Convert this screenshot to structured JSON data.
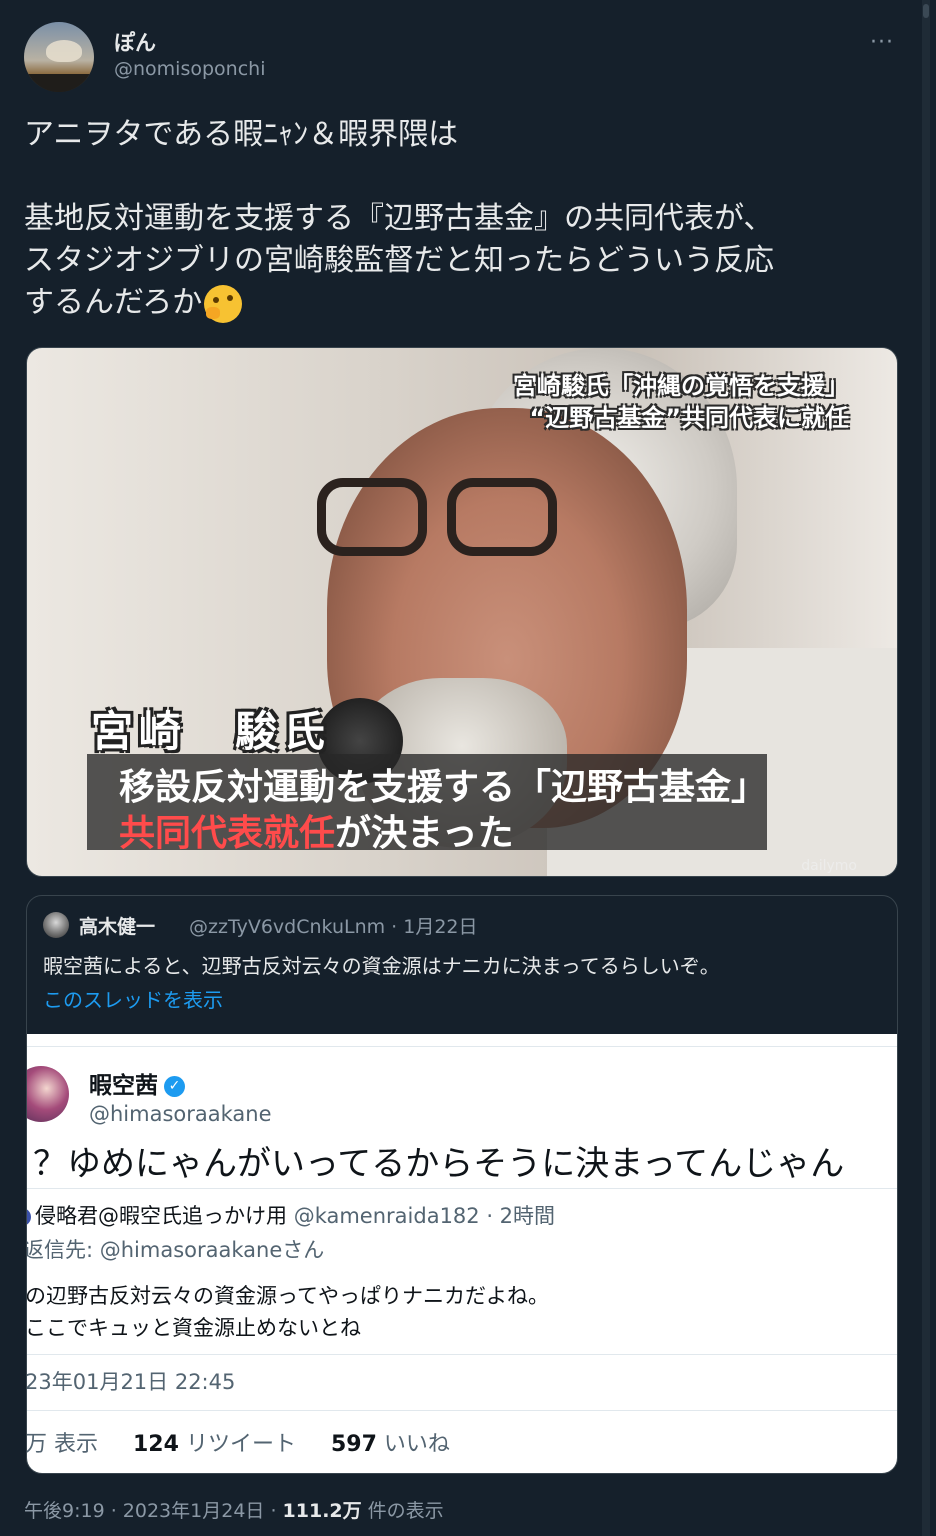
{
  "author": {
    "name": "ぽん",
    "handle": "@nomisoponchi",
    "more_label": "···"
  },
  "tweet": {
    "line1": "アニヲタである暇ﾆｬﾝ＆暇界隈は",
    "line2": "基地反対運動を支援する『辺野古基金』の共同代表が、",
    "line3": "スタジオジブリの宮崎駿監督だと知ったらどういう反応",
    "line4": "するんだろか",
    "emoji": "thinking-face"
  },
  "media": {
    "caption_top_1": "宮崎駿氏「沖縄の覚悟を支援」",
    "caption_top_2": "“辺野古基金”共同代表に就任",
    "caption_name": "宮崎　駿氏",
    "caption_line1": "移設反対運動を支援する「辺野古基金」",
    "caption_line2_red": "共同代表就任",
    "caption_line2_rest": "が決まった",
    "watermark": "dailymo"
  },
  "quote": {
    "name": "高木健一",
    "meta": "@zzTyV6vdCnkuLnm · 1月22日",
    "text": "暇空茜によると、辺野古反対云々の資金源はナニカに決まってるらしいぞ。",
    "link": "このスレッドを表示",
    "screenshot": {
      "name": "暇空茜",
      "handle": "@himasoraakane",
      "text": "？ゆめにゃんがいってるからそうに決まってんじゃん",
      "reply_name": "侵略君@暇空氏追っかけ用",
      "reply_meta": "@kamenraida182 · 2時間",
      "reply_to": "返信先: @himasoraakaneさん",
      "body1": "の辺野古反対云々の資金源ってやっぱりナニカだよね。",
      "body2": "ここでキュッと資金源止めないとね",
      "timestamp": "23年01月21日 22:45",
      "views_label": "万 表示",
      "retweets": "124",
      "retweets_label": "リツイート",
      "likes": "597",
      "likes_label": "いいね"
    }
  },
  "footer": {
    "time": "午後9:19 · 2023年1月24日 · ",
    "views": "111.2万",
    "views_label": " 件の表示"
  }
}
